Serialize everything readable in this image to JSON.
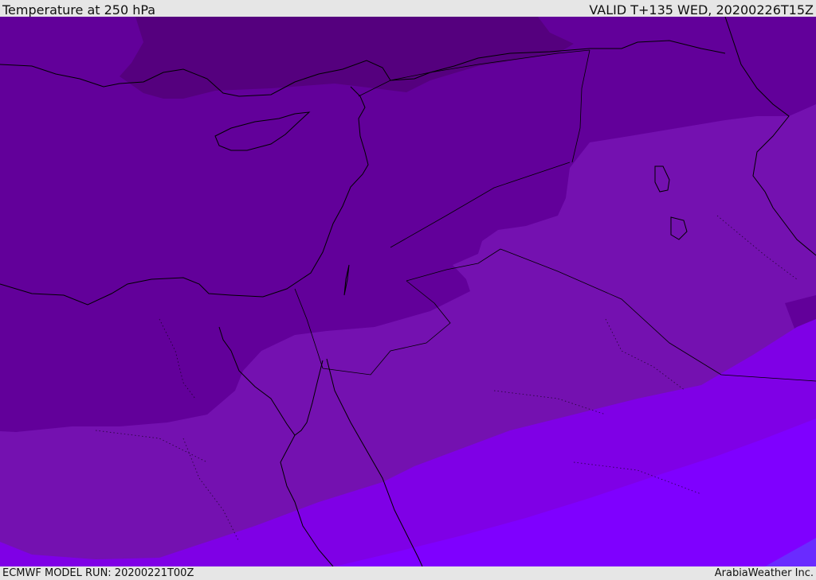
{
  "header": {
    "title": "Temperature at 250 hPa",
    "valid_time": "VALID T+135 WED, 20200226T15Z"
  },
  "footer": {
    "model_run": "ECMWF MODEL RUN: 20200221T00Z",
    "credit": "ArabiaWeather Inc."
  },
  "map": {
    "field": "temperature",
    "level": "250 hPa",
    "colors": {
      "band_coldest": "#55007e",
      "band_cold": "#62009a",
      "band_mid": "#7411b0",
      "band_warm": "#7f00e6",
      "band_warmest": "#7f00ff",
      "band_warmest_edge": "#6a2bff",
      "coastline": "#000000",
      "border": "#000000"
    }
  }
}
